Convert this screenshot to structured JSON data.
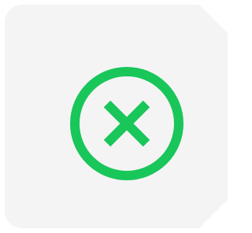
{
  "dialog": {
    "state": "error",
    "icon": "close-circle-icon",
    "accent_color": "#19c65a",
    "card_color": "#f4f4f4"
  }
}
